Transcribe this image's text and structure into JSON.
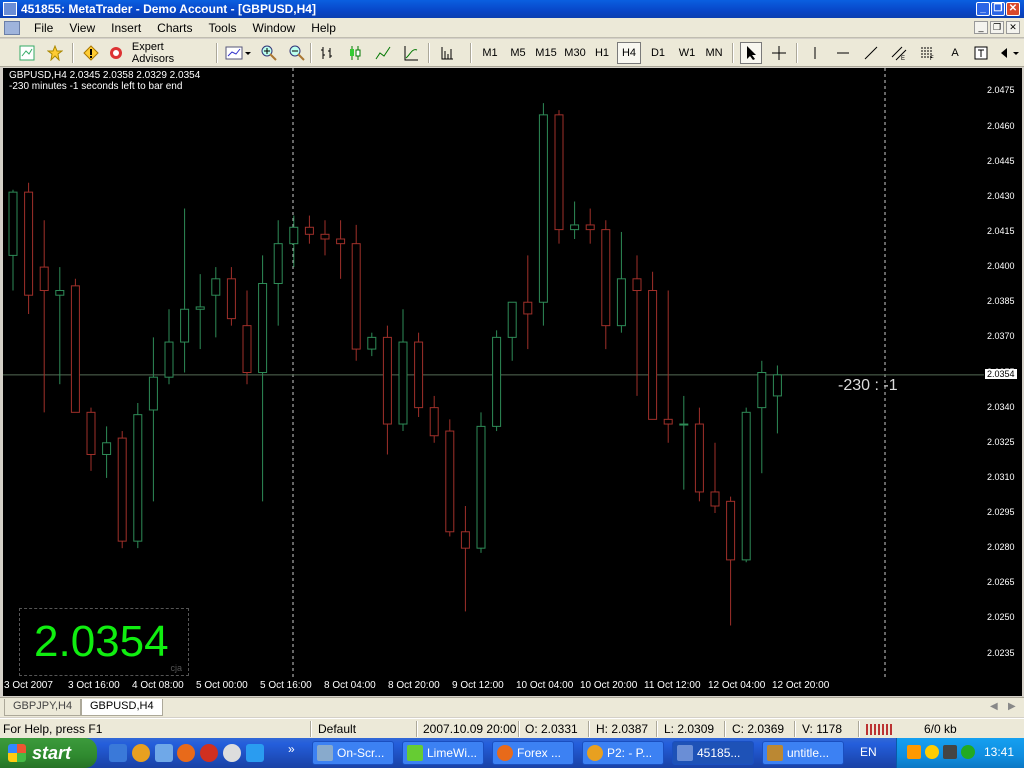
{
  "window": {
    "title": "451855: MetaTrader - Demo Account - [GBPUSD,H4]",
    "minimize": "_",
    "restore": "❐",
    "close": "✕"
  },
  "menu": [
    "File",
    "View",
    "Insert",
    "Charts",
    "Tools",
    "Window",
    "Help"
  ],
  "toolbar": {
    "expert_advisors": "Expert Advisors",
    "timeframes": [
      "M1",
      "M5",
      "M15",
      "M30",
      "H1",
      "H4",
      "D1",
      "W1",
      "MN"
    ],
    "active_timeframe": "H4",
    "text_tool": "A"
  },
  "chart": {
    "info_line1": "GBPUSD,H4  2.0345 2.0358 2.0329 2.0354",
    "info_line2": "-230 minutes -1 seconds left to bar end",
    "big_price": "2.0354",
    "big_price_tag": "cja",
    "countdown": "-230 : -1",
    "current_price": "2.0354",
    "colors": {
      "bull": "#2e8b57",
      "bear": "#a0302a",
      "bg": "#000000",
      "grid": "#ffffff",
      "big_price": "#10ee10"
    }
  },
  "chart_data": {
    "type": "candlestick",
    "symbol": "GBPUSD",
    "timeframe": "H4",
    "ylim": [
      2.0225,
      2.0485
    ],
    "y_ticks": [
      "2.0475",
      "2.0460",
      "2.0445",
      "2.0430",
      "2.0415",
      "2.0400",
      "2.0385",
      "2.0370",
      "2.0355",
      "2.0340",
      "2.0325",
      "2.0310",
      "2.0295",
      "2.0280",
      "2.0265",
      "2.0250",
      "2.0235"
    ],
    "x_ticks": [
      "3 Oct 2007",
      "3 Oct 16:00",
      "4 Oct 08:00",
      "5 Oct 00:00",
      "5 Oct 16:00",
      "8 Oct 04:00",
      "8 Oct 20:00",
      "9 Oct 12:00",
      "10 Oct 04:00",
      "10 Oct 20:00",
      "11 Oct 12:00",
      "12 Oct 04:00",
      "12 Oct 20:00"
    ],
    "candles": [
      {
        "o": 2.0405,
        "h": 2.0433,
        "l": 2.039,
        "c": 2.0432
      },
      {
        "o": 2.0432,
        "h": 2.0436,
        "l": 2.038,
        "c": 2.0388
      },
      {
        "o": 2.04,
        "h": 2.042,
        "l": 2.0338,
        "c": 2.039
      },
      {
        "o": 2.0388,
        "h": 2.04,
        "l": 2.035,
        "c": 2.039
      },
      {
        "o": 2.0392,
        "h": 2.0395,
        "l": 2.0338,
        "c": 2.0338
      },
      {
        "o": 2.0338,
        "h": 2.034,
        "l": 2.0313,
        "c": 2.032
      },
      {
        "o": 2.032,
        "h": 2.0332,
        "l": 2.031,
        "c": 2.0325
      },
      {
        "o": 2.0327,
        "h": 2.033,
        "l": 2.028,
        "c": 2.0283
      },
      {
        "o": 2.0283,
        "h": 2.0342,
        "l": 2.028,
        "c": 2.0337
      },
      {
        "o": 2.0339,
        "h": 2.037,
        "l": 2.03,
        "c": 2.0353
      },
      {
        "o": 2.0353,
        "h": 2.0382,
        "l": 2.035,
        "c": 2.0368
      },
      {
        "o": 2.0368,
        "h": 2.0425,
        "l": 2.0355,
        "c": 2.0382
      },
      {
        "o": 2.0382,
        "h": 2.0397,
        "l": 2.0365,
        "c": 2.0383
      },
      {
        "o": 2.0388,
        "h": 2.04,
        "l": 2.037,
        "c": 2.0395
      },
      {
        "o": 2.0395,
        "h": 2.04,
        "l": 2.0375,
        "c": 2.0378
      },
      {
        "o": 2.0375,
        "h": 2.039,
        "l": 2.035,
        "c": 2.0355
      },
      {
        "o": 2.0355,
        "h": 2.0405,
        "l": 2.03,
        "c": 2.0393
      },
      {
        "o": 2.0393,
        "h": 2.042,
        "l": 2.0375,
        "c": 2.041
      },
      {
        "o": 2.041,
        "h": 2.0422,
        "l": 2.04,
        "c": 2.0417
      },
      {
        "o": 2.0417,
        "h": 2.0422,
        "l": 2.041,
        "c": 2.0414
      },
      {
        "o": 2.0414,
        "h": 2.042,
        "l": 2.0405,
        "c": 2.0412
      },
      {
        "o": 2.0412,
        "h": 2.042,
        "l": 2.0395,
        "c": 2.041
      },
      {
        "o": 2.041,
        "h": 2.0418,
        "l": 2.036,
        "c": 2.0365
      },
      {
        "o": 2.0365,
        "h": 2.0372,
        "l": 2.0362,
        "c": 2.037
      },
      {
        "o": 2.037,
        "h": 2.0375,
        "l": 2.032,
        "c": 2.0333
      },
      {
        "o": 2.0333,
        "h": 2.0382,
        "l": 2.033,
        "c": 2.0368
      },
      {
        "o": 2.0368,
        "h": 2.0372,
        "l": 2.0336,
        "c": 2.034
      },
      {
        "o": 2.034,
        "h": 2.0345,
        "l": 2.0325,
        "c": 2.0328
      },
      {
        "o": 2.033,
        "h": 2.0335,
        "l": 2.0285,
        "c": 2.0287
      },
      {
        "o": 2.0287,
        "h": 2.0298,
        "l": 2.0253,
        "c": 2.028
      },
      {
        "o": 2.028,
        "h": 2.0338,
        "l": 2.0278,
        "c": 2.0332
      },
      {
        "o": 2.0332,
        "h": 2.0373,
        "l": 2.033,
        "c": 2.037
      },
      {
        "o": 2.037,
        "h": 2.0385,
        "l": 2.036,
        "c": 2.0385
      },
      {
        "o": 2.0385,
        "h": 2.0405,
        "l": 2.0365,
        "c": 2.038
      },
      {
        "o": 2.0385,
        "h": 2.047,
        "l": 2.0375,
        "c": 2.0465
      },
      {
        "o": 2.0465,
        "h": 2.0467,
        "l": 2.041,
        "c": 2.0416
      },
      {
        "o": 2.0416,
        "h": 2.0428,
        "l": 2.0412,
        "c": 2.0418
      },
      {
        "o": 2.0418,
        "h": 2.0425,
        "l": 2.041,
        "c": 2.0416
      },
      {
        "o": 2.0416,
        "h": 2.042,
        "l": 2.0365,
        "c": 2.0375
      },
      {
        "o": 2.0375,
        "h": 2.0415,
        "l": 2.0372,
        "c": 2.0395
      },
      {
        "o": 2.0395,
        "h": 2.0405,
        "l": 2.0345,
        "c": 2.039
      },
      {
        "o": 2.039,
        "h": 2.0398,
        "l": 2.034,
        "c": 2.0335
      },
      {
        "o": 2.0335,
        "h": 2.039,
        "l": 2.0325,
        "c": 2.0333
      },
      {
        "o": 2.0333,
        "h": 2.0345,
        "l": 2.0305,
        "c": 2.0333
      },
      {
        "o": 2.0333,
        "h": 2.034,
        "l": 2.03,
        "c": 2.0304
      },
      {
        "o": 2.0304,
        "h": 2.0325,
        "l": 2.0295,
        "c": 2.0298
      },
      {
        "o": 2.03,
        "h": 2.0302,
        "l": 2.0247,
        "c": 2.0275
      },
      {
        "o": 2.0275,
        "h": 2.034,
        "l": 2.0274,
        "c": 2.0338
      },
      {
        "o": 2.034,
        "h": 2.036,
        "l": 2.0312,
        "c": 2.0355
      },
      {
        "o": 2.0345,
        "h": 2.0358,
        "l": 2.0329,
        "c": 2.0354
      }
    ]
  },
  "tabs": [
    "GBPJPY,H4",
    "GBPUSD,H4"
  ],
  "active_tab": "GBPUSD,H4",
  "status": {
    "help": "For Help, press F1",
    "profile": "Default",
    "datetime": "2007.10.09 20:00",
    "open": "O: 2.0331",
    "high": "H: 2.0387",
    "low": "L: 2.0309",
    "close": "C: 2.0369",
    "volume": "V: 1178",
    "traffic": "6/0 kb"
  },
  "taskbar": {
    "start": "start",
    "overflow": "»",
    "tasks": [
      "On-Scr...",
      "LimeWi...",
      "Forex ...",
      "P2: - P...",
      "45185...",
      "untitle..."
    ],
    "language": "EN",
    "clock": "13:41"
  }
}
